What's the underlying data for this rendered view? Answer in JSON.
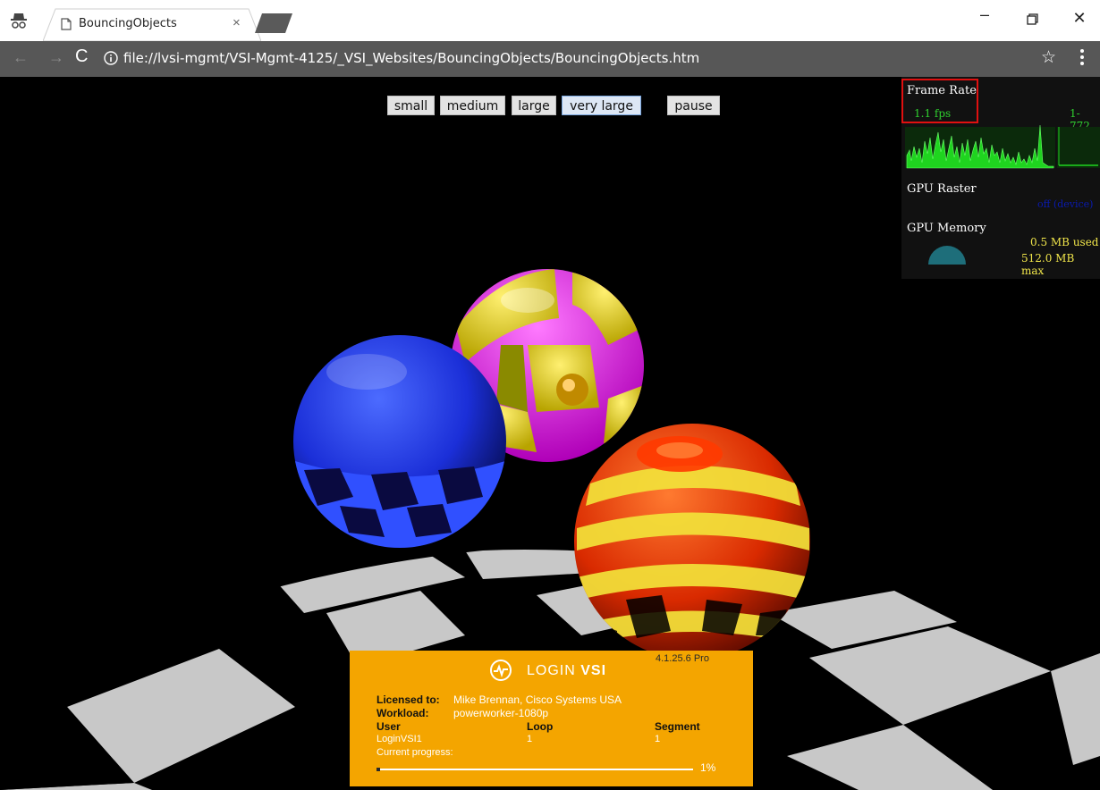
{
  "window": {
    "tab_title": "BouncingObjects",
    "close_tab_glyph": "×",
    "minimize_glyph": "–",
    "close_glyph": "✕"
  },
  "toolbar": {
    "url": "file://lvsi-mgmt/VSI-Mgmt-4125/_VSI_Websites/BouncingObjects/BouncingObjects.htm",
    "back_glyph": "←",
    "forward_glyph": "→",
    "reload_glyph": "C",
    "bookmark_glyph": "☆"
  },
  "controls": {
    "size_buttons": [
      "small",
      "medium",
      "large",
      "very large"
    ],
    "active_size": "very large",
    "pause_label": "pause"
  },
  "hud": {
    "frame_rate_title": "Frame Rate",
    "fps": "1.1 fps",
    "fps_range": "1-772",
    "gpu_raster_title": "GPU Raster",
    "gpu_raster_value": "off (device)",
    "gpu_memory_title": "GPU Memory",
    "memory_used": "0.5 MB used",
    "memory_max": "512.0 MB max",
    "memory_used_fraction": 0.001
  },
  "vsi": {
    "logo_text_light": "LOGIN ",
    "logo_text_bold": "VSI",
    "version": "4.1.25.6 Pro",
    "licensed_to_label": "Licensed to:",
    "licensed_to": "Mike Brennan, Cisco Systems USA",
    "workload_label": "Workload:",
    "workload": "powerworker-1080p",
    "col_user": "User",
    "col_loop": "Loop",
    "col_segment": "Segment",
    "user": "LoginVSI1",
    "loop": "1",
    "segment": "1",
    "progress_label": "Current progress:",
    "progress_text": "1%",
    "progress_fraction": 0.01
  },
  "colors": {
    "chrome_toolbar": "#575757",
    "hud_green": "#2fd12f",
    "hud_yellow": "#f0e54a",
    "vsi_orange": "#f4a500",
    "highlight_red": "#e01010"
  }
}
